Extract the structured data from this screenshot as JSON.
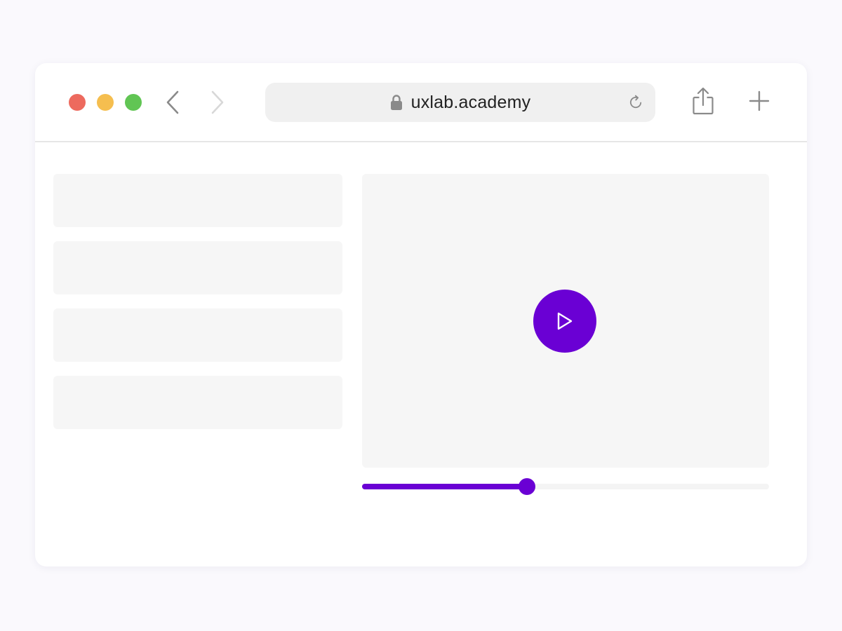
{
  "colors": {
    "close": "#ed6a5e",
    "minimize": "#f5be4f",
    "zoom": "#61c554",
    "accent": "#6a00d4",
    "icon": "#8a8a8a",
    "icon_disabled": "#d8d8d8"
  },
  "toolbar": {
    "icons": {
      "back": "chevron-left-icon",
      "forward": "chevron-right-icon",
      "lock": "lock-icon",
      "reload": "reload-icon",
      "share": "share-icon",
      "new_tab": "plus-icon"
    }
  },
  "address_bar": {
    "url": "uxlab.academy"
  },
  "content": {
    "list_items": 4,
    "video": {
      "play_icon": "play-icon",
      "progress": 0.405
    }
  }
}
